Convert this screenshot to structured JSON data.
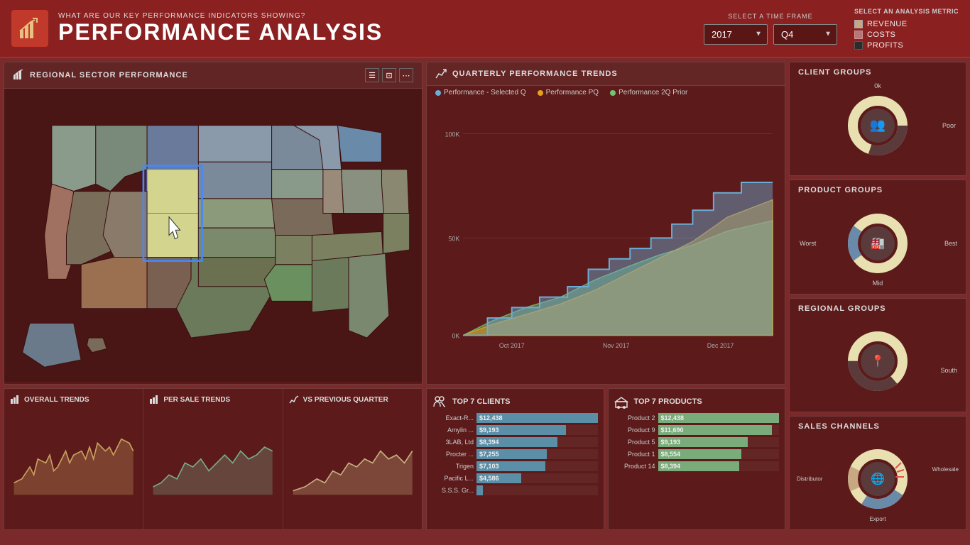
{
  "header": {
    "subtitle": "What are our key performance indicators showing?",
    "title": "Performance Analysis",
    "timeframe_label": "Select a Time Frame",
    "year_value": "2017",
    "quarter_value": "Q4",
    "analysis_label": "Select an Analysis Metric",
    "metrics": [
      {
        "label": "Revenue",
        "type": "revenue"
      },
      {
        "label": "Costs",
        "type": "costs"
      },
      {
        "label": "Profits",
        "type": "profits"
      }
    ]
  },
  "map_panel": {
    "title": "Regional Sector Performance"
  },
  "quarterly_panel": {
    "title": "Quarterly Performance Trends",
    "legend": [
      {
        "label": "Performance - Selected Q",
        "color": "blue"
      },
      {
        "label": "Performance PQ",
        "color": "orange"
      },
      {
        "label": "Performance 2Q Prior",
        "color": "green"
      }
    ],
    "y_labels": [
      "0K",
      "50K",
      "100K"
    ],
    "x_labels": [
      "Oct 2017",
      "Nov 2017",
      "Dec 2017"
    ]
  },
  "client_groups": {
    "title": "Client Groups",
    "labels": {
      "top": "0k",
      "right": "Poor"
    },
    "icon": "👥"
  },
  "product_groups": {
    "title": "Product Groups",
    "labels": {
      "left": "Worst",
      "right": "Best",
      "bottom": "Mid"
    },
    "icon": "🏭"
  },
  "regional_groups": {
    "title": "Regional Groups",
    "labels": {
      "right": "South"
    },
    "icon": "📍"
  },
  "sales_channels": {
    "title": "Sales Channels",
    "labels": {
      "left": "Distributor",
      "right": "Wholesale",
      "bottom": "Export"
    },
    "icon": "🌐"
  },
  "overall_trends": {
    "title": "Overall Trends"
  },
  "per_sale_trends": {
    "title": "Per Sale Trends"
  },
  "vs_previous_quarter": {
    "title": "VS Previous Quarter"
  },
  "top7_clients": {
    "title": "Top 7 Clients",
    "items": [
      {
        "label": "Exact-R...",
        "value": "$12,438",
        "pct": 100
      },
      {
        "label": "Amylin ...",
        "value": "$9,193",
        "pct": 74
      },
      {
        "label": "3LAB, Ltd",
        "value": "$8,394",
        "pct": 67
      },
      {
        "label": "Procter ...",
        "value": "$7,255",
        "pct": 58
      },
      {
        "label": "Trigen",
        "value": "$7,103",
        "pct": 57
      },
      {
        "label": "Pacific L...",
        "value": "$4,586",
        "pct": 37
      },
      {
        "label": "S.S.S. Gr...",
        "value": "",
        "pct": 5
      }
    ]
  },
  "top7_products": {
    "title": "Top 7 Products",
    "items": [
      {
        "label": "Product 2",
        "value": "$12,438",
        "pct": 100
      },
      {
        "label": "Product 9",
        "value": "$11,690",
        "pct": 94
      },
      {
        "label": "Product 5",
        "value": "$9,193",
        "pct": 74
      },
      {
        "label": "Product 1",
        "value": "$8,554",
        "pct": 69
      },
      {
        "label": "Product 14",
        "value": "$8,394",
        "pct": 67
      }
    ]
  }
}
